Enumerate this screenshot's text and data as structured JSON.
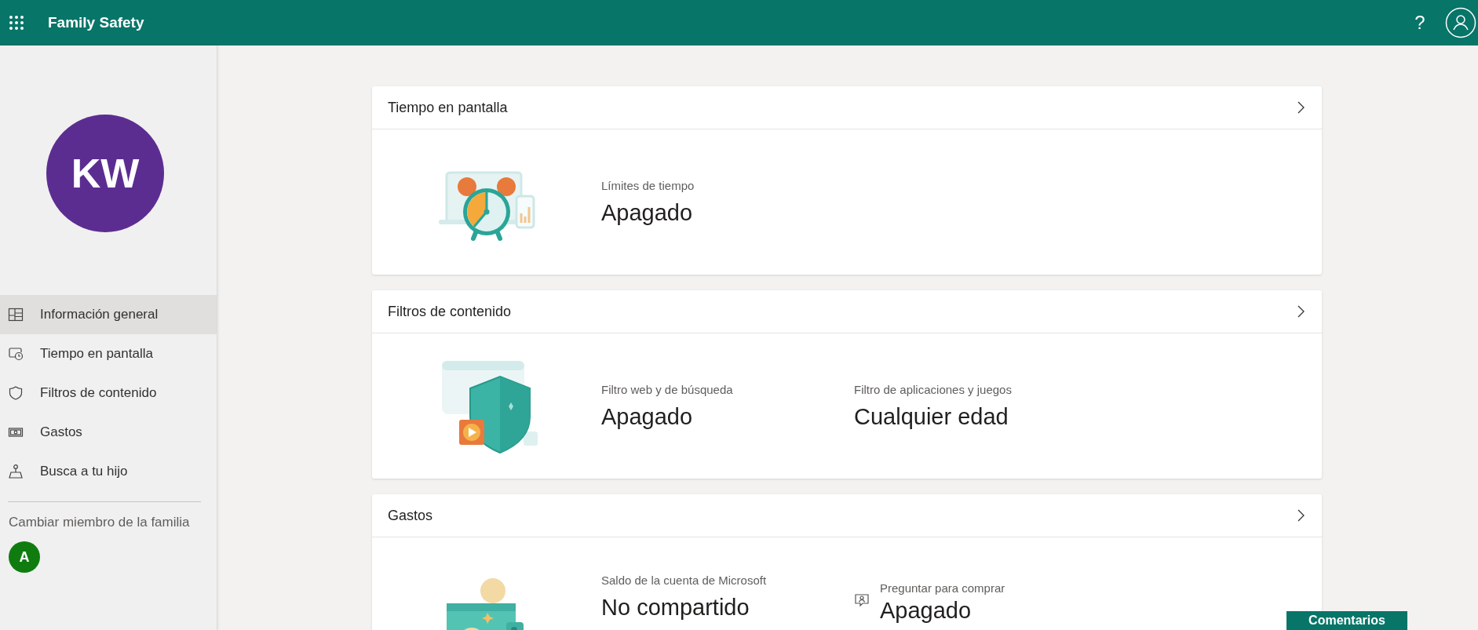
{
  "header": {
    "title": "Family Safety",
    "help": "?"
  },
  "profile": {
    "initials": "KW",
    "color": "#5c2d91"
  },
  "sidebar": {
    "items": [
      {
        "label": "Información general",
        "selected": true
      },
      {
        "label": "Tiempo en pantalla",
        "selected": false
      },
      {
        "label": "Filtros de contenido",
        "selected": false
      },
      {
        "label": "Gastos",
        "selected": false
      },
      {
        "label": "Busca a tu hijo",
        "selected": false
      }
    ],
    "switch_member": {
      "label": "Cambiar miembro de la familia",
      "members": [
        {
          "initial": "A",
          "color": "#107c10"
        }
      ]
    }
  },
  "cards": [
    {
      "title": "Tiempo en pantalla",
      "stats": [
        {
          "kind": "plain",
          "label": "Límites de tiempo",
          "value": "Apagado"
        }
      ]
    },
    {
      "title": "Filtros de contenido",
      "stats": [
        {
          "kind": "plain",
          "label": "Filtro web y de búsqueda",
          "value": "Apagado"
        },
        {
          "kind": "plain",
          "label": "Filtro de aplicaciones y juegos",
          "value": "Cualquier edad"
        }
      ]
    },
    {
      "title": "Gastos",
      "stats": [
        {
          "kind": "plain",
          "label": "Saldo de la cuenta de Microsoft",
          "value": "No compartido"
        },
        {
          "kind": "iconed",
          "label": "Preguntar para comprar",
          "value": "Apagado"
        }
      ]
    }
  ],
  "feedback_button": "Comentarios"
}
